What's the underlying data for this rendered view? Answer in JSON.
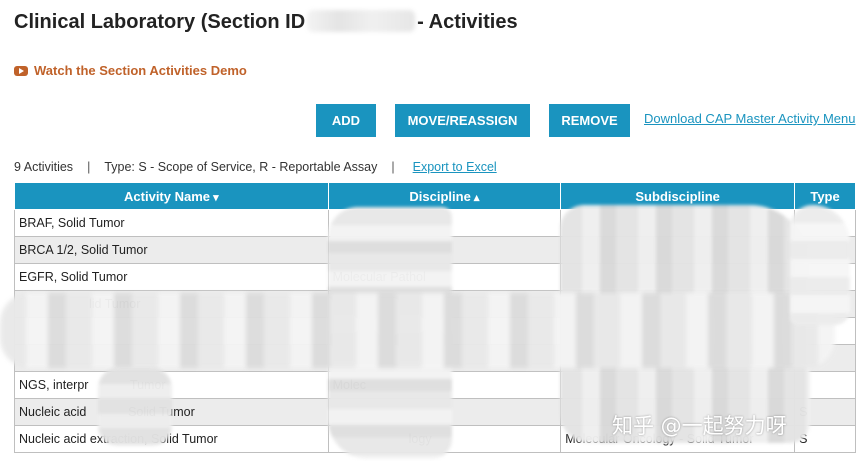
{
  "page": {
    "title_prefix": "Clinical Laboratory (Section ID",
    "title_suffix": "- Activities"
  },
  "demo_link": {
    "label": "Watch the Section Activities Demo",
    "icon": "video-play-icon"
  },
  "toolbar": {
    "add_label": "ADD",
    "move_label": "MOVE/REASSIGN",
    "remove_label": "REMOVE",
    "cap_link_label": "Download CAP Master Activity Menu"
  },
  "summary": {
    "count": "9 Activities",
    "type_legend": "Type: S - Scope of Service, R - Reportable Assay",
    "export_label": "Export to Excel"
  },
  "table": {
    "headers": {
      "name": "Activity Name",
      "discipline": "Discipline",
      "subdiscipline": "Subdiscipline",
      "type": "Type"
    },
    "rows": [
      {
        "name": "BRAF, Solid Tumor",
        "discipline": "",
        "subdiscipline": "",
        "type": ""
      },
      {
        "name": "BRCA 1/2, Solid Tumor",
        "discipline": "",
        "subdiscipline": "",
        "type": ""
      },
      {
        "name": "EGFR, Solid Tumor",
        "discipline": "Molecular Pathol",
        "subdiscipline": "",
        "type": ""
      },
      {
        "name": "lid Tumor",
        "discipline": "M",
        "subdiscipline": "",
        "type": ""
      },
      {
        "name": "",
        "discipline": "",
        "subdiscipline": "",
        "type": ""
      },
      {
        "name": "",
        "discipline": "",
        "subdiscipline": "",
        "type": ""
      },
      {
        "name": "NGS, interpr            Tumor",
        "discipline": "Molec",
        "subdiscipline": "",
        "type": ""
      },
      {
        "name": "Nucleic acid            Solid Tumor",
        "discipline": "",
        "subdiscipline": "",
        "type": "S"
      },
      {
        "name": "Nucleic acid extraction, Solid Tumor",
        "discipline": "logy",
        "subdiscipline": "Molecular Oncology - Solid Tumor",
        "type": "S"
      }
    ]
  },
  "watermark": "知乎 @一起努力呀",
  "colors": {
    "accent": "#1a94bf",
    "demo_link": "#c0622a"
  }
}
